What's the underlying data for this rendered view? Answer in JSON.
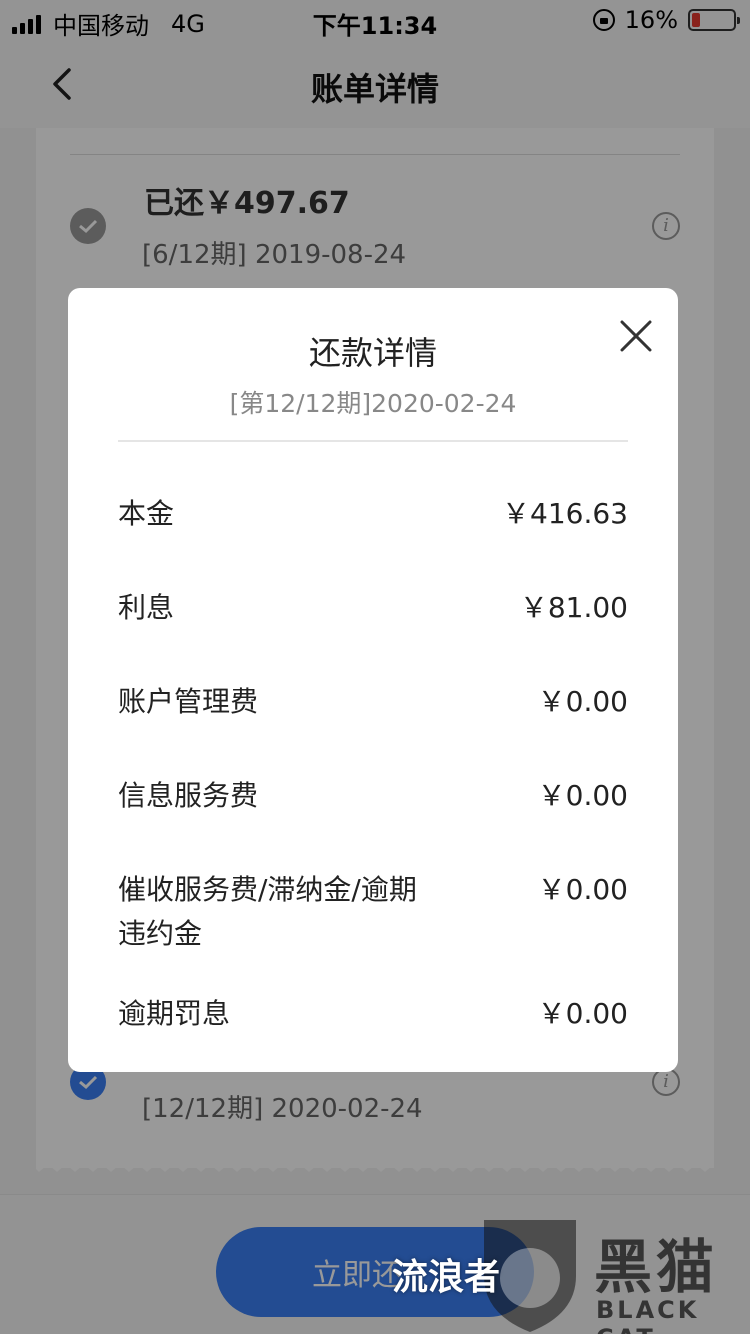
{
  "status_bar": {
    "carrier": "中国移动",
    "network": "4G",
    "time": "下午11:34",
    "battery": "16%"
  },
  "nav": {
    "title": "账单详情"
  },
  "receipt": {
    "top_item": {
      "amount": "已还￥497.67",
      "period": "[6/12期] 2019-08-24"
    },
    "bottom_item": {
      "period": "[12/12期] 2020-02-24"
    }
  },
  "bottom": {
    "pay_button": "立即还"
  },
  "modal": {
    "title": "还款详情",
    "subtitle": "[第12/12期]2020-02-24",
    "items": [
      {
        "label": "本金",
        "value": "￥416.63"
      },
      {
        "label": "利息",
        "value": "￥81.00"
      },
      {
        "label": "账户管理费",
        "value": "￥0.00"
      },
      {
        "label": "信息服务费",
        "value": "￥0.00"
      },
      {
        "label": "催收服务费/滞纳金/逾期违约金",
        "value": "￥0.00"
      },
      {
        "label": "逾期罚息",
        "value": "￥0.00"
      }
    ]
  },
  "watermark": {
    "brand_cn": "黑猫",
    "brand_en": "BLACK CAT",
    "user": "流浪者"
  },
  "colors": {
    "accent": "#3b7ff3",
    "battery_low": "#e53a30"
  },
  "icons": [
    "signal-icon",
    "rotation-lock-icon",
    "battery-icon",
    "back-chevron-icon",
    "check-circle-icon",
    "info-icon",
    "close-icon"
  ]
}
